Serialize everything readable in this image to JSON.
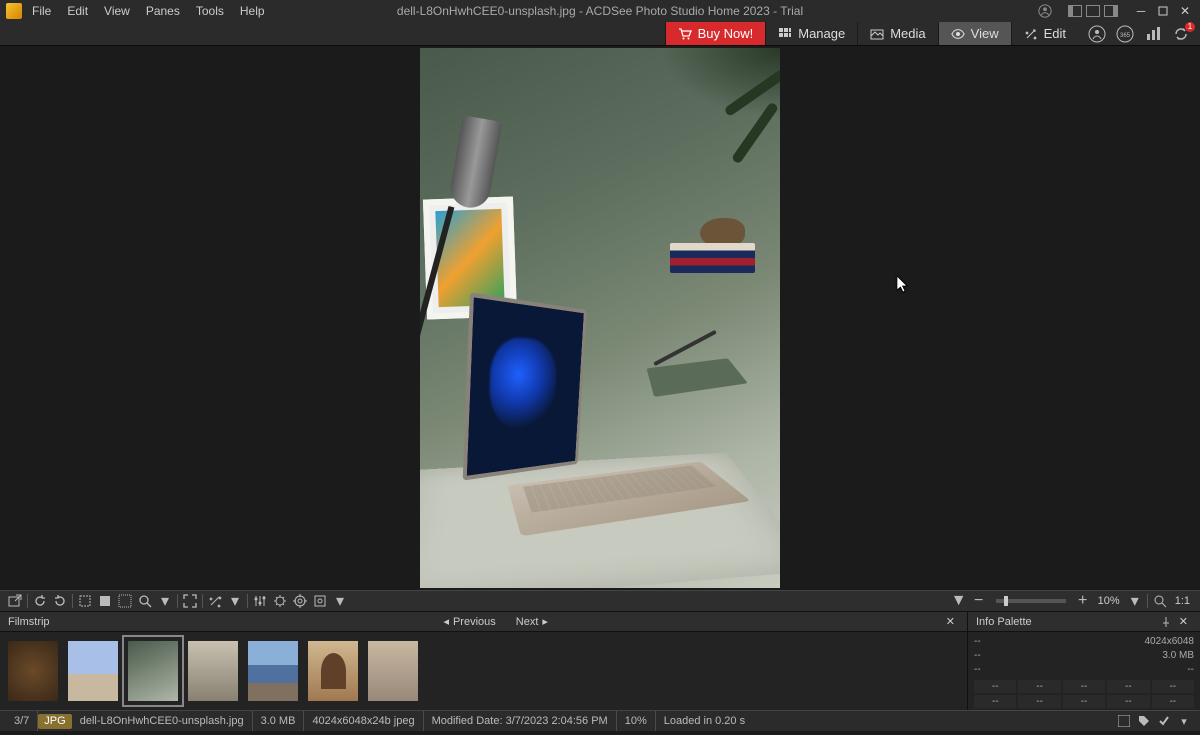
{
  "menu": {
    "file": "File",
    "edit": "Edit",
    "view": "View",
    "panes": "Panes",
    "tools": "Tools",
    "help": "Help"
  },
  "title": "dell-L8OnHwhCEE0-unsplash.jpg - ACDSee Photo Studio Home 2023 - Trial",
  "modes": {
    "buy": "Buy Now!",
    "manage": "Manage",
    "media": "Media",
    "view": "View",
    "edit": "Edit"
  },
  "notification_badge": "1",
  "zoom": {
    "pct": "10%",
    "one": "1:1"
  },
  "filmstrip": {
    "title": "Filmstrip",
    "prev": "Previous",
    "next": "Next"
  },
  "info": {
    "title": "Info Palette",
    "dim": "4024x6048",
    "size": "3.0 MB",
    "dash": "--"
  },
  "status": {
    "counter": "3/7",
    "format": "JPG",
    "filename": "dell-L8OnHwhCEE0-unsplash.jpg",
    "size": "3.0 MB",
    "dims": "4024x6048x24b jpeg",
    "modified": "Modified Date: 3/7/2023 2:04:56 PM",
    "zoom": "10%",
    "loaded": "Loaded in 0.20 s"
  }
}
